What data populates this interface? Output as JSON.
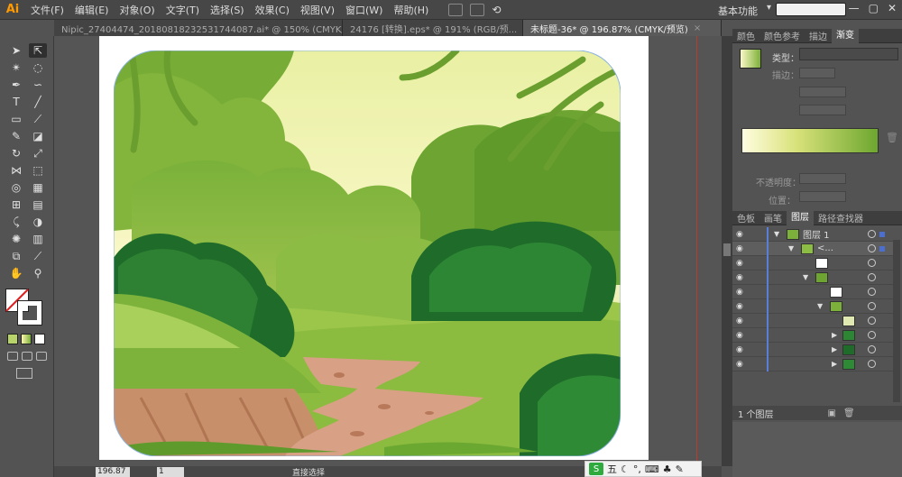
{
  "app": {
    "logo": "Ai"
  },
  "menubar": {
    "items": [
      "文件(F)",
      "编辑(E)",
      "对象(O)",
      "文字(T)",
      "选择(S)",
      "效果(C)",
      "视图(V)",
      "窗口(W)",
      "帮助(H)"
    ],
    "workspace": "基本功能",
    "window_controls": [
      "—",
      "▢",
      "✕"
    ]
  },
  "tabs": [
    {
      "label": "Nipic_27404474_20180818232531744087.ai* @ 150% (CMYK/预...",
      "close": "×"
    },
    {
      "label": "24176 [转换].eps* @ 191% (RGB/预...",
      "close": "×"
    },
    {
      "label": "未标题-36* @ 196.87% (CMYK/预览)",
      "close": "×"
    }
  ],
  "status": {
    "zoom": "196.87",
    "page": "1",
    "tool": "直接选择"
  },
  "gradient_panel": {
    "tabs": [
      "颜色",
      "颜色参考",
      "描边",
      "渐变"
    ],
    "type_label": "类型：",
    "stroke_label": "描边：",
    "opacity_label": "不透明度：",
    "position_label": "位置："
  },
  "layers_panel": {
    "tabs": [
      "色板",
      "画笔",
      "图层",
      "路径查找器"
    ],
    "layer1": "图层 1",
    "sublayer": "<...",
    "footer": "1 个图层"
  },
  "ime": {
    "label": "五",
    "logo": "S"
  },
  "colors": {
    "accent": "#2f6fe0",
    "guide": "#c0392b"
  }
}
